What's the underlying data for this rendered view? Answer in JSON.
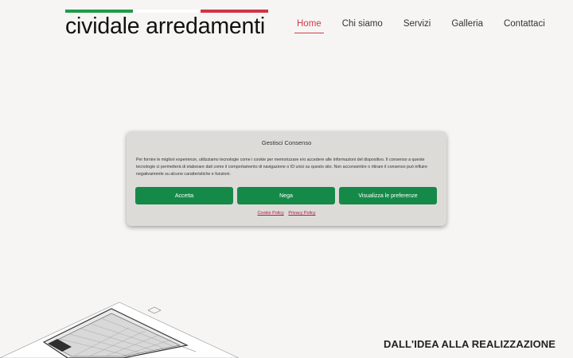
{
  "brand": {
    "name": "cividale arredamenti",
    "flag_colors": [
      "#1f9a48",
      "#ffffff",
      "#cf3643"
    ]
  },
  "nav": {
    "items": [
      {
        "label": "Home",
        "active": true
      },
      {
        "label": "Chi siamo",
        "active": false
      },
      {
        "label": "Servizi",
        "active": false
      },
      {
        "label": "Galleria",
        "active": false
      },
      {
        "label": "Contattaci",
        "active": false
      }
    ],
    "active_color": "#d33b45"
  },
  "consent": {
    "title": "Gestisci Consenso",
    "body": "Per fornire le migliori esperienze, utilizziamo tecnologie come i cookie per memorizzare e/o accedere alle informazioni del dispositivo. Il consenso a queste tecnologie ci permetterà di elaborare dati come il comportamento di navigazione o ID unici su questo sito. Non acconsentire o ritirare il consenso può influire negativamente su alcune caratteristiche e funzioni.",
    "buttons": {
      "accept": "Accetta",
      "deny": "Nega",
      "preferences": "Visualizza le preferenze"
    },
    "links": {
      "cookie_policy": "Cookie Policy",
      "privacy_policy": "Privacy Policy"
    },
    "button_color": "#158a48"
  },
  "hero": {
    "heading": "DALL'IDEA ALLA REALIZZAZIONE"
  }
}
